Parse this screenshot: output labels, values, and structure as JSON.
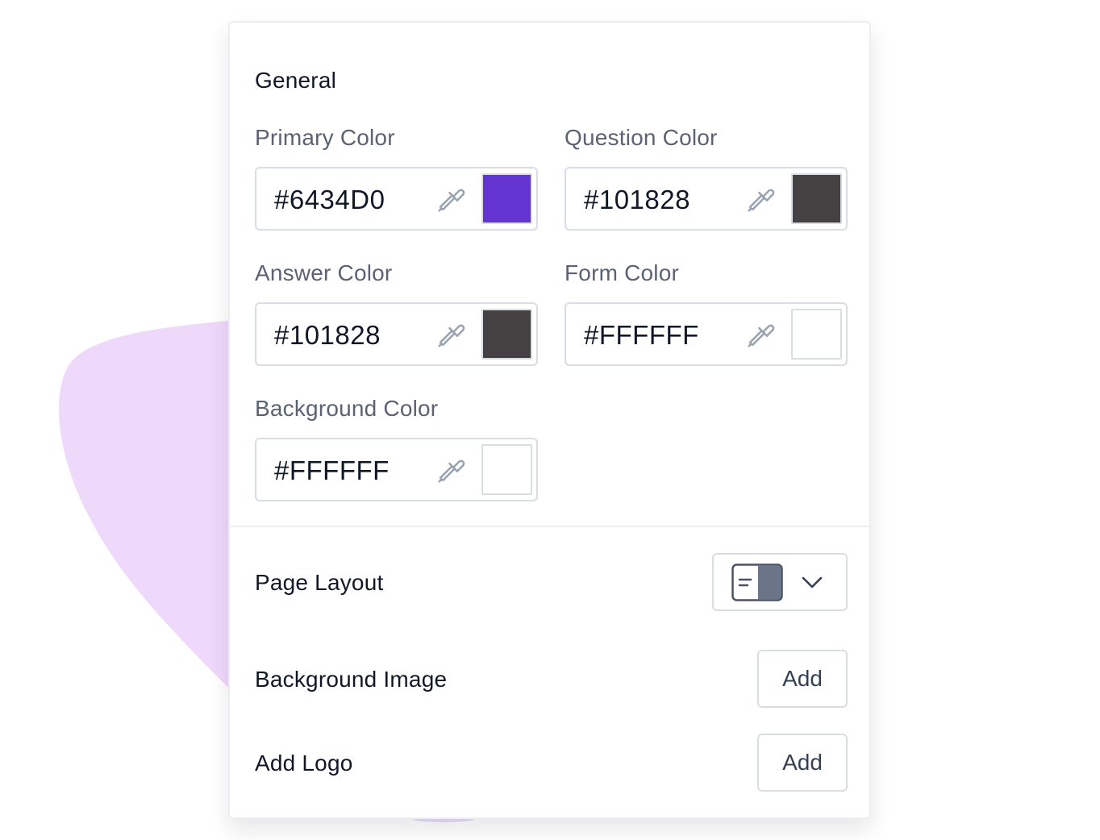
{
  "general": {
    "title": "General",
    "fields": [
      {
        "label": "Primary Color",
        "value": "#6434D0",
        "swatch": "#6434D0"
      },
      {
        "label": "Question Color",
        "value": "#101828",
        "swatch": "#454142"
      },
      {
        "label": "Answer Color",
        "value": "#101828",
        "swatch": "#454142"
      },
      {
        "label": "Form Color",
        "value": "#FFFFFF",
        "swatch": "#FFFFFF"
      },
      {
        "label": "Background Color",
        "value": "#FFFFFF",
        "swatch": "#FFFFFF"
      }
    ],
    "picker_icon": "eyedropper-icon"
  },
  "page_layout": {
    "label": "Page Layout",
    "selected_icon": "split-layout-icon",
    "dropdown_icon": "chevron-down-icon"
  },
  "background_image": {
    "label": "Background Image",
    "button": "Add"
  },
  "logo": {
    "label": "Add Logo",
    "button": "Add"
  },
  "colors": {
    "blob": "#efd9fb",
    "text": "#101828",
    "label": "#5a6274",
    "border": "#d9dde4",
    "icon": "#98a2b3"
  }
}
